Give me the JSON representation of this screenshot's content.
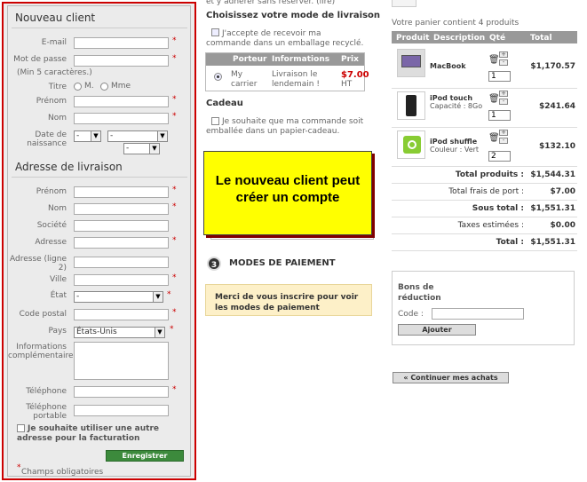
{
  "new_client": {
    "title": "Nouveau client",
    "email_label": "E-mail",
    "password_label": "Mot de passe",
    "password_hint": "(Min 5 caractères.)",
    "title_label": "Titre",
    "mr": "M.",
    "mrs": "Mme",
    "firstname_label": "Prénom",
    "lastname_label": "Nom",
    "birthdate_label": "Date de naissance",
    "day": "-",
    "month": "-",
    "year": "-"
  },
  "address": {
    "title": "Adresse de livraison",
    "firstname_label": "Prénom",
    "lastname_label": "Nom",
    "company_label": "Société",
    "address_label": "Adresse",
    "address2_label": "Adresse (ligne 2)",
    "city_label": "Ville",
    "state_label": "État",
    "state_value": "-",
    "zip_label": "Code postal",
    "country_label": "Pays",
    "country_value": "États-Unis",
    "info_label": "Informations complémentaires",
    "phone_label": "Téléphone",
    "mobile_label": "Téléphone portable",
    "billing_checkbox": "Je souhaite utiliser une autre adresse pour la facturation",
    "register_button": "Enregistrer",
    "required_note": "Champs obligatoires"
  },
  "delivery": {
    "top_fragment": "et y adhérer sans réserver. (lire)",
    "title": "Choisissez votre mode de livraison",
    "recycle_checkbox": "J'accepte de recevoir ma commande dans un emballage recyclé.",
    "headers": [
      "Porteur",
      "Informations",
      "Prix"
    ],
    "carrier": "My carrier",
    "carrier_info": "Livraison le lendemain !",
    "price": "$7.00",
    "price_note": "HT",
    "gift_title": "Cadeau",
    "gift_checkbox": "Je souhaite que ma commande soit emballée dans un papier-cadeau."
  },
  "callout": "Le nouveau client peut créer un compte",
  "payment": {
    "step": "3",
    "title": "MODES DE PAIEMENT",
    "notice": "Merci de vous inscrire pour voir les modes de paiement"
  },
  "cart": {
    "summary": "Votre panier contient 4 produits",
    "headers": [
      "Produit",
      "Description",
      "Qté",
      "Total"
    ],
    "items": [
      {
        "name": "MacBook",
        "desc": "",
        "qty": "1",
        "total": "$1,170.57"
      },
      {
        "name": "iPod touch",
        "desc": "Capacité : 8Go",
        "qty": "1",
        "total": "$241.64"
      },
      {
        "name": "iPod shuffle",
        "desc": "Couleur : Vert",
        "qty": "2",
        "total": "$132.10"
      }
    ],
    "totals": [
      {
        "label": "Total produits :",
        "value": "$1,544.31",
        "bold": true
      },
      {
        "label": "Total frais de port :",
        "value": "$7.00",
        "bold": false
      },
      {
        "label": "Sous total :",
        "value": "$1,551.31",
        "bold": true
      },
      {
        "label": "Taxes estimées :",
        "value": "$0.00",
        "bold": false
      },
      {
        "label": "Total :",
        "value": "$1,551.31",
        "bold": true
      }
    ],
    "voucher_title": "Bons de réduction",
    "voucher_code_label": "Code :",
    "voucher_button": "Ajouter",
    "continue_button": "« Continuer mes achats"
  },
  "colors": {
    "accent": "#cc0000",
    "header": "#999999",
    "callout": "#ffff00",
    "notice": "#fdf0c8",
    "button_green": "#3c8a3c"
  }
}
